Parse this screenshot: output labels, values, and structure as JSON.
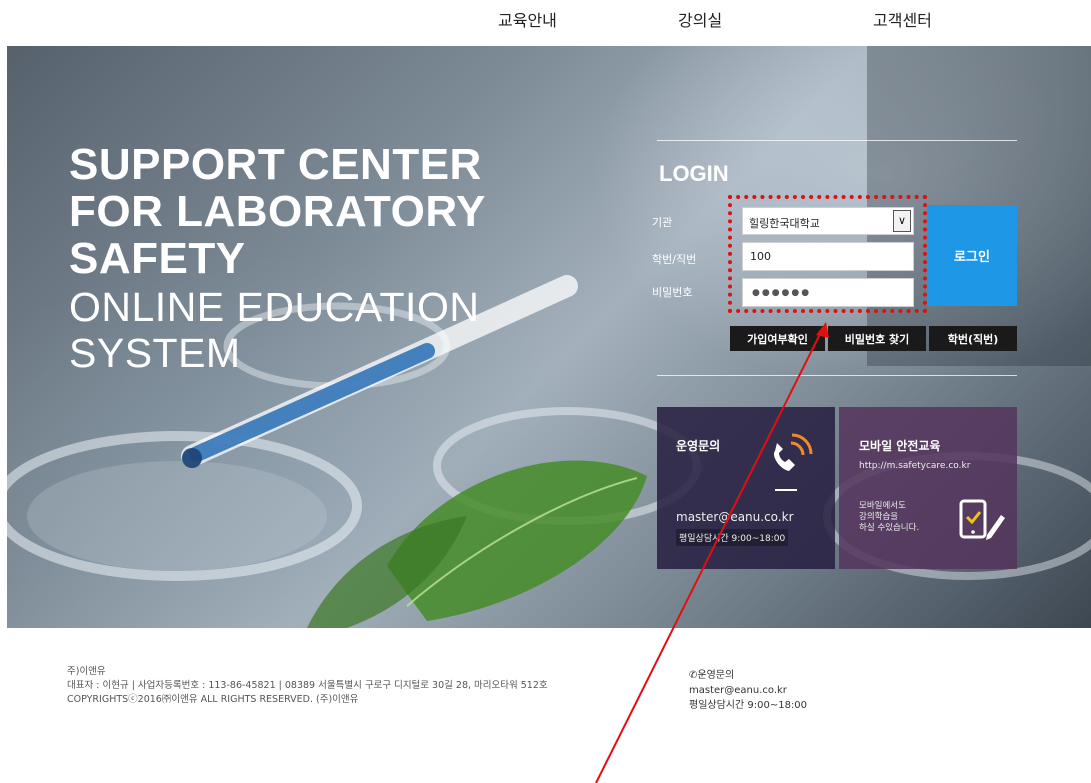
{
  "nav": {
    "items": [
      "교육안내",
      "강의실",
      "고객센터"
    ]
  },
  "hero": {
    "title_line1": "SUPPORT CENTER",
    "title_line2": "FOR LABORATORY",
    "title_line3": "SAFETY",
    "subtitle_line1": "ONLINE EDUCATION",
    "subtitle_line2": "SYSTEM"
  },
  "login": {
    "title": "LOGIN",
    "institution_label": "기관",
    "institution_value": "힐링한국대학교",
    "id_label": "학번/직번",
    "id_value": "100",
    "password_label": "비밀번호",
    "password_masked": "●●●●●●",
    "submit_label": "로그인",
    "buttons": [
      "가입여부확인",
      "비밀번호 찾기",
      "학번(직번)"
    ]
  },
  "support_panel": {
    "title": "운영문의",
    "email": "master@eanu.co.kr",
    "hours": "평일상담시간 9:00~18:00"
  },
  "mobile_panel": {
    "title": "모바일 안전교육",
    "url": "http://m.safetycare.co.kr",
    "desc_line1": "모바일에서도",
    "desc_line2": "강의학습을",
    "desc_line3": "하실 수있습니다."
  },
  "footer": {
    "company": "주)이앤유",
    "info": "대표자 : 이현규 | 사업자등록번호 : 113-86-45821 | 08389 서울특별시 구로구 디지털로 30길 28, 마리오타워 512호",
    "copyright": "COPYRIGHTSⓒ2016㈜이앤유 ALL RIGHTS RESERVED. (주)이앤유",
    "contact_title": "운영문의",
    "contact_email": "master@eanu.co.kr",
    "contact_hours": "평일상담시간 9:00~18:00"
  },
  "colors": {
    "login_button": "#1e97e6",
    "highlight_annotation": "#dd1111",
    "support_panel": "#261e40",
    "mobile_panel": "#54345c"
  }
}
